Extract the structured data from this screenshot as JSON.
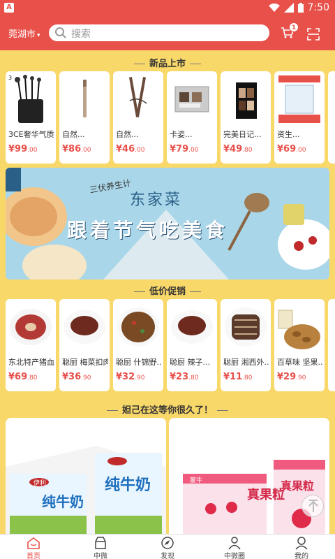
{
  "status": {
    "time": "7:50",
    "app_badge": "A"
  },
  "header": {
    "city": "莞湖市",
    "search_placeholder": "搜索",
    "cart_count": "1"
  },
  "sections": {
    "new": "新品上市",
    "promo": "低价促销",
    "waiting": "妲己在这等你很久了！"
  },
  "new_products": [
    {
      "name": "3CE奢华气质...",
      "price_int": "¥99",
      "price_dec": ".00"
    },
    {
      "name": "自然...",
      "price_int": "¥86",
      "price_dec": ".00"
    },
    {
      "name": "自然...",
      "price_int": "¥46",
      "price_dec": ".00"
    },
    {
      "name": "卡姿...",
      "price_int": "¥79",
      "price_dec": ".00"
    },
    {
      "name": "完美日记...",
      "price_int": "¥49",
      "price_dec": ".80"
    },
    {
      "name": "资生...",
      "price_int": "¥69",
      "price_dec": ".00"
    }
  ],
  "promo_products": [
    {
      "name": "东北特产猪血...",
      "price_int": "¥69",
      "price_dec": ".80"
    },
    {
      "name": "聪厨 梅菜扣肉...",
      "price_int": "¥36",
      "price_dec": ".90"
    },
    {
      "name": "聪厨 什锦野...",
      "price_int": "¥32",
      "price_dec": ".90"
    },
    {
      "name": "聪厨 辣子...",
      "price_int": "¥23",
      "price_dec": ".80"
    },
    {
      "name": "聪厨 湘西外...",
      "price_int": "¥11",
      "price_dec": ".80"
    },
    {
      "name": "百草味 坚果...",
      "price_int": "¥29",
      "price_dec": ".90"
    }
  ],
  "banner": {
    "small": "三伏养生计",
    "brand": "东家菜",
    "headline": "跟着节气吃美食",
    "corner": "东家菜"
  },
  "big_products": [
    {
      "brand": "伊利",
      "label": "纯牛奶"
    },
    {
      "brand": "蒙牛",
      "label": "真果粒"
    }
  ],
  "tabs": [
    {
      "label": "首页",
      "icon": "home-icon"
    },
    {
      "label": "中微",
      "icon": "store-icon"
    },
    {
      "label": "发现",
      "icon": "compass-icon"
    },
    {
      "label": "中微圈",
      "icon": "people-icon"
    },
    {
      "label": "我的",
      "icon": "user-icon"
    }
  ],
  "colors": {
    "primary": "#e8504a",
    "background": "#f9d86a"
  }
}
